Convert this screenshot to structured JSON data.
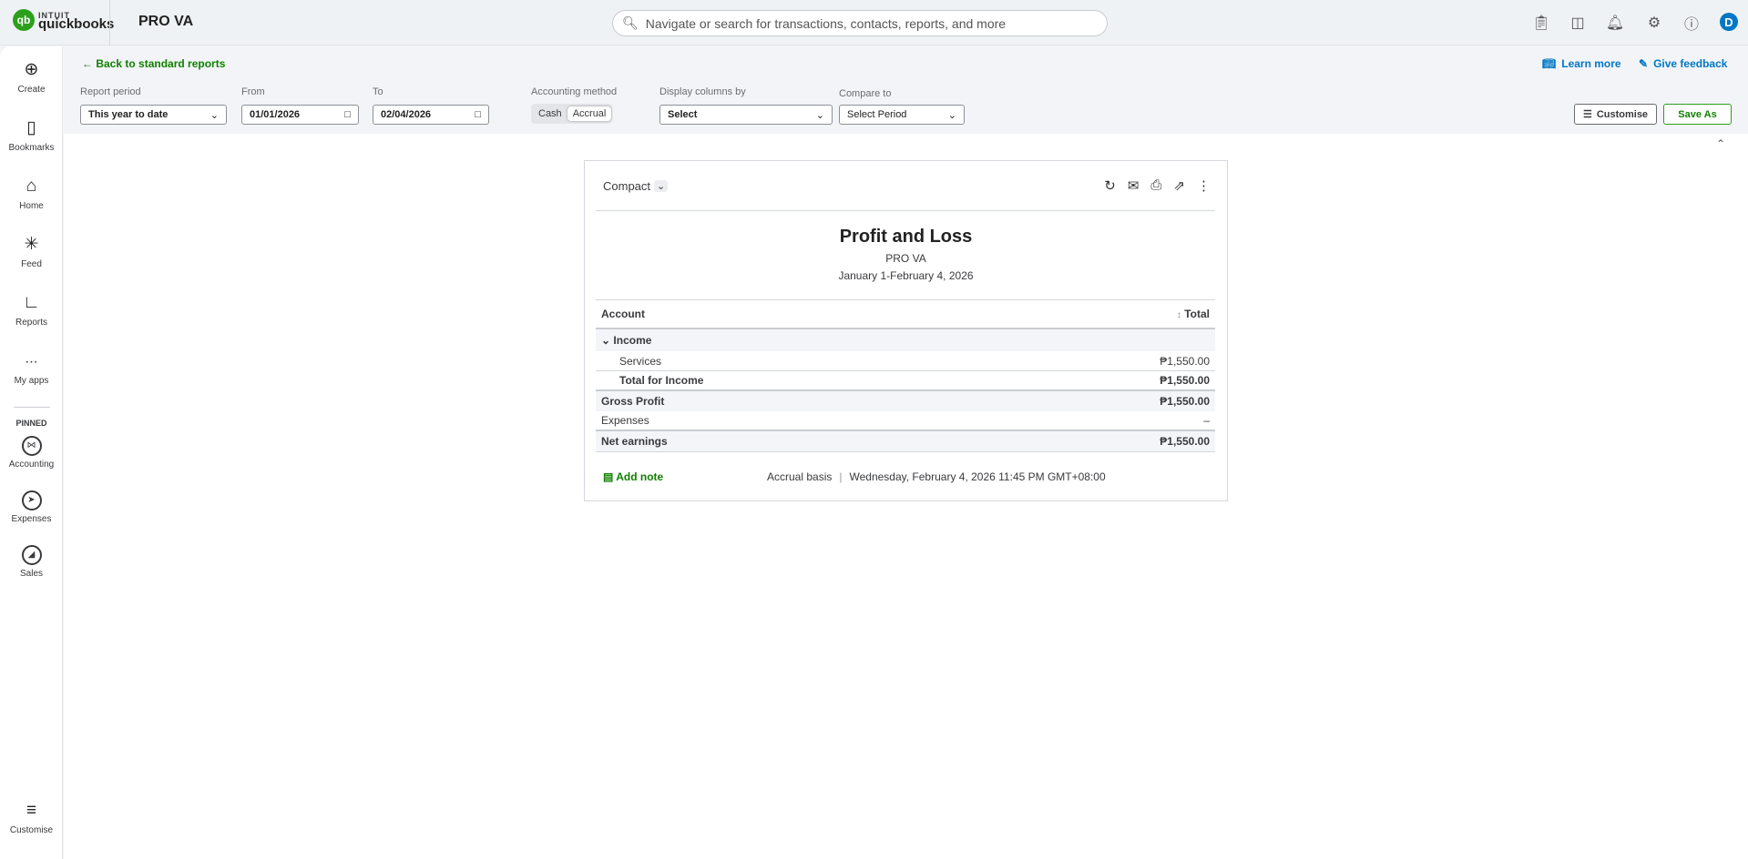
{
  "topbar": {
    "logo_top": "INTUIT",
    "logo_bottom": "quickbooks",
    "company": "PRO VA",
    "search_placeholder": "Navigate or search for transactions, contacts, reports, and more",
    "avatar": "D"
  },
  "sidebar": {
    "items": [
      {
        "label": "Create",
        "icon": "plus-circle-icon"
      },
      {
        "label": "Bookmarks",
        "icon": "bookmark-icon"
      },
      {
        "label": "Home",
        "icon": "home-icon"
      },
      {
        "label": "Feed",
        "icon": "feed-icon"
      },
      {
        "label": "Reports",
        "icon": "chart-icon"
      },
      {
        "label": "My apps",
        "icon": "grid-icon"
      }
    ],
    "pinned_label": "PINNED",
    "pinned": [
      {
        "label": "Accounting"
      },
      {
        "label": "Expenses"
      },
      {
        "label": "Sales"
      }
    ],
    "customise": "Customise"
  },
  "filters": {
    "back": "Back to standard reports",
    "report_period_label": "Report period",
    "report_period": "This year to date",
    "from_label": "From",
    "from": "01/01/2026",
    "to_label": "To",
    "to": "02/04/2026",
    "method_label": "Accounting method",
    "cash": "Cash",
    "accrual": "Accrual",
    "display_label": "Display columns by",
    "display": "Select",
    "compare_label": "Compare to",
    "compare": "Select Period",
    "learn_more": "Learn more",
    "feedback": "Give feedback",
    "customise": "Customise",
    "save_as": "Save As"
  },
  "report": {
    "view": "Compact",
    "title": "Profit and Loss",
    "company": "PRO VA",
    "period": "January 1-February 4, 2026",
    "col_account": "Account",
    "col_total": "Total",
    "rows": [
      {
        "label": "Income",
        "value": ""
      },
      {
        "label": "Services",
        "value": "₱1,550.00"
      },
      {
        "label": "Total for Income",
        "value": "₱1,550.00"
      },
      {
        "label": "Gross Profit",
        "value": "₱1,550.00"
      },
      {
        "label": "Expenses",
        "value": "–"
      },
      {
        "label": "Net earnings",
        "value": "₱1,550.00"
      }
    ],
    "add_note": "Add note",
    "basis": "Accrual basis",
    "timestamp": "Wednesday, February 4, 2026 11:45 PM GMT+08:00"
  }
}
